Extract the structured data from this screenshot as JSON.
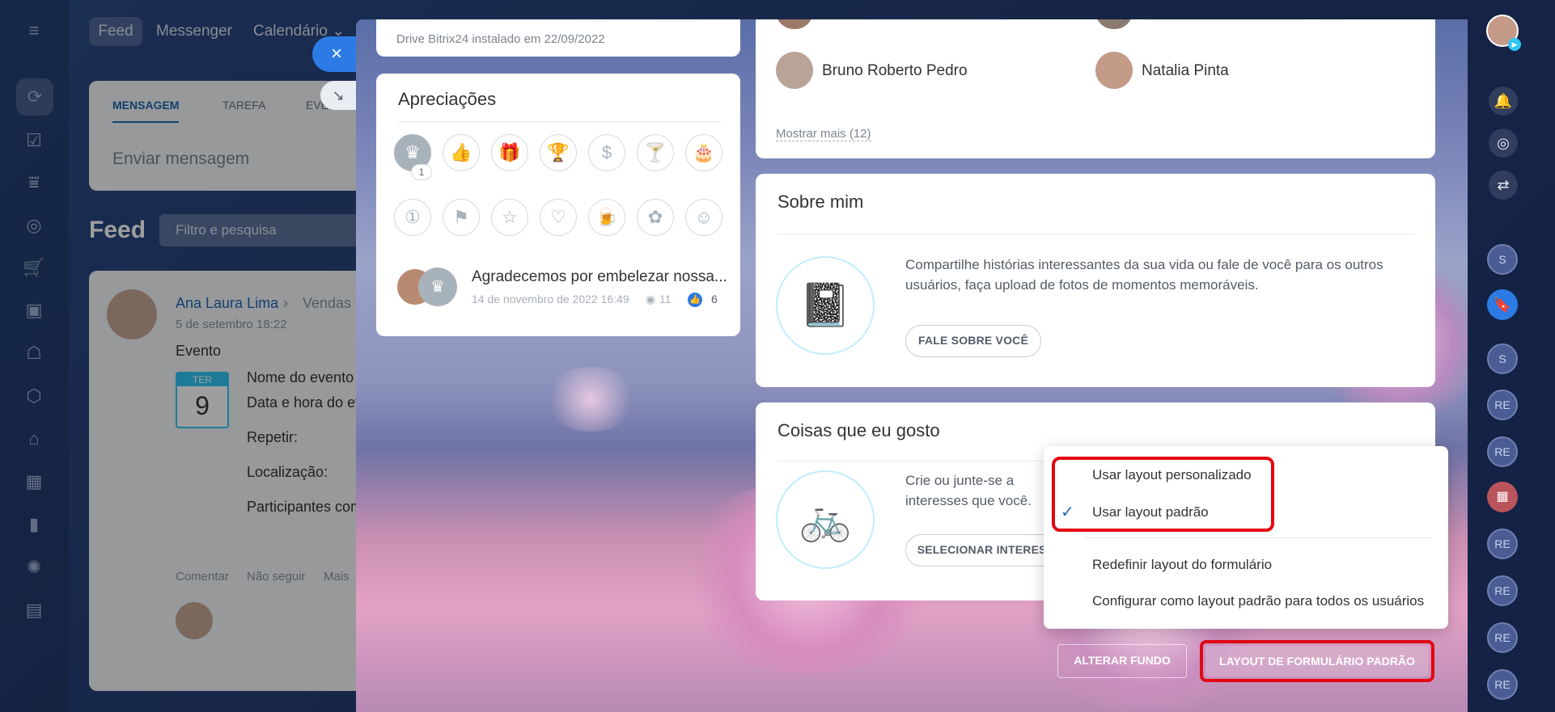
{
  "feed": {
    "nav": [
      "Feed",
      "Messenger",
      "Calendário"
    ],
    "composer_tabs": [
      "MENSAGEM",
      "TAREFA",
      "EVENTO"
    ],
    "composer_placeholder": "Enviar mensagem",
    "title": "Feed",
    "search_placeholder": "Filtro e pesquisa",
    "post": {
      "author": "Ana Laura Lima",
      "destination": "Vendas",
      "date": "5 de setembro 18:22",
      "type": "Evento",
      "cal_day_name": "TER",
      "cal_day_num": "9",
      "fields": [
        "Nome do evento",
        "Data e hora do evento",
        "Repetir:",
        "Localização:",
        "Participantes com"
      ],
      "actions": [
        "Comentar",
        "Não seguir",
        "Mais"
      ]
    }
  },
  "profile": {
    "drive_note": "Drive Bitrix24 instalado em 22/09/2022",
    "appreciations": {
      "title": "Apreciações",
      "badge_count": "1",
      "item_text": "Agradecemos por embelezar nossa...",
      "item_date": "14 de novembro de 2022 16:49",
      "item_views": "11",
      "item_likes": "6"
    },
    "people": [
      "Bruno Roberto Pedro",
      "Natalia Pinta"
    ],
    "show_more": "Mostrar mais (12)",
    "about": {
      "title": "Sobre mim",
      "text": "Compartilhe histórias interessantes da sua vida ou fale de você para os outros usuários, faça upload de fotos de momentos memoráveis.",
      "button": "FALE SOBRE VOCÊ"
    },
    "likes": {
      "title": "Coisas que eu gosto",
      "text": "Crie ou junte-se a interesses que você.",
      "button": "SELECIONAR INTERESSES"
    },
    "footer": {
      "change_bg": "ALTERAR FUNDO",
      "default_layout": "LAYOUT DE FORMULÁRIO PADRÃO"
    }
  },
  "context_menu": {
    "items": [
      "Usar layout personalizado",
      "Usar layout padrão",
      "Redefinir layout do formulário",
      "Configurar como layout padrão para todos os usuários"
    ],
    "checked_index": 1
  },
  "rightbar": {
    "avatars": [
      "S",
      "S",
      "RE",
      "RE",
      "RE",
      "RE",
      "RE",
      "RE"
    ]
  },
  "colors": {
    "accent": "#2fc6f6",
    "link": "#2067b0",
    "highlight": "#e30613",
    "blue_button": "#2c7be5"
  },
  "icons": [
    "menu-icon",
    "close-icon",
    "collapse-icon",
    "crown-icon",
    "thumbs-up-icon",
    "gift-icon",
    "trophy-icon",
    "money-bag-icon",
    "cocktail-icon",
    "cake-icon",
    "number-one-icon",
    "flag-icon",
    "star-icon",
    "heart-icon",
    "beer-icon",
    "flower-icon",
    "smile-icon",
    "bell-icon",
    "target-icon",
    "sync-icon",
    "check-icon"
  ]
}
